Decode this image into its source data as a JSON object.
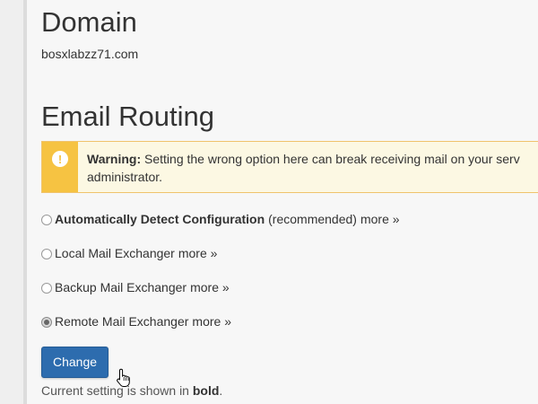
{
  "domain_section": {
    "title": "Domain",
    "value": "bosxlabzz71.com"
  },
  "routing_section": {
    "title": "Email Routing",
    "warning": {
      "icon": "exclamation-icon",
      "label": "Warning:",
      "text": "Setting the wrong option here can break receiving mail on your serv",
      "text_line2": "administrator."
    },
    "options": [
      {
        "label": "Automatically Detect Configuration",
        "suffix": "(recommended)",
        "more": "more »",
        "selected": false
      },
      {
        "label": "Local Mail Exchanger",
        "more": "more »",
        "selected": false
      },
      {
        "label": "Backup Mail Exchanger",
        "more": "more »",
        "selected": false
      },
      {
        "label": "Remote Mail Exchanger",
        "more": "more »",
        "selected": true
      }
    ],
    "change_button": "Change",
    "footer": {
      "prefix": "Current setting is shown in",
      "bold": "bold",
      "suffix": "."
    }
  },
  "colors": {
    "primary_button": "#2d6cae",
    "warning_accent": "#f6c342",
    "warning_background": "#fcf8e3"
  }
}
